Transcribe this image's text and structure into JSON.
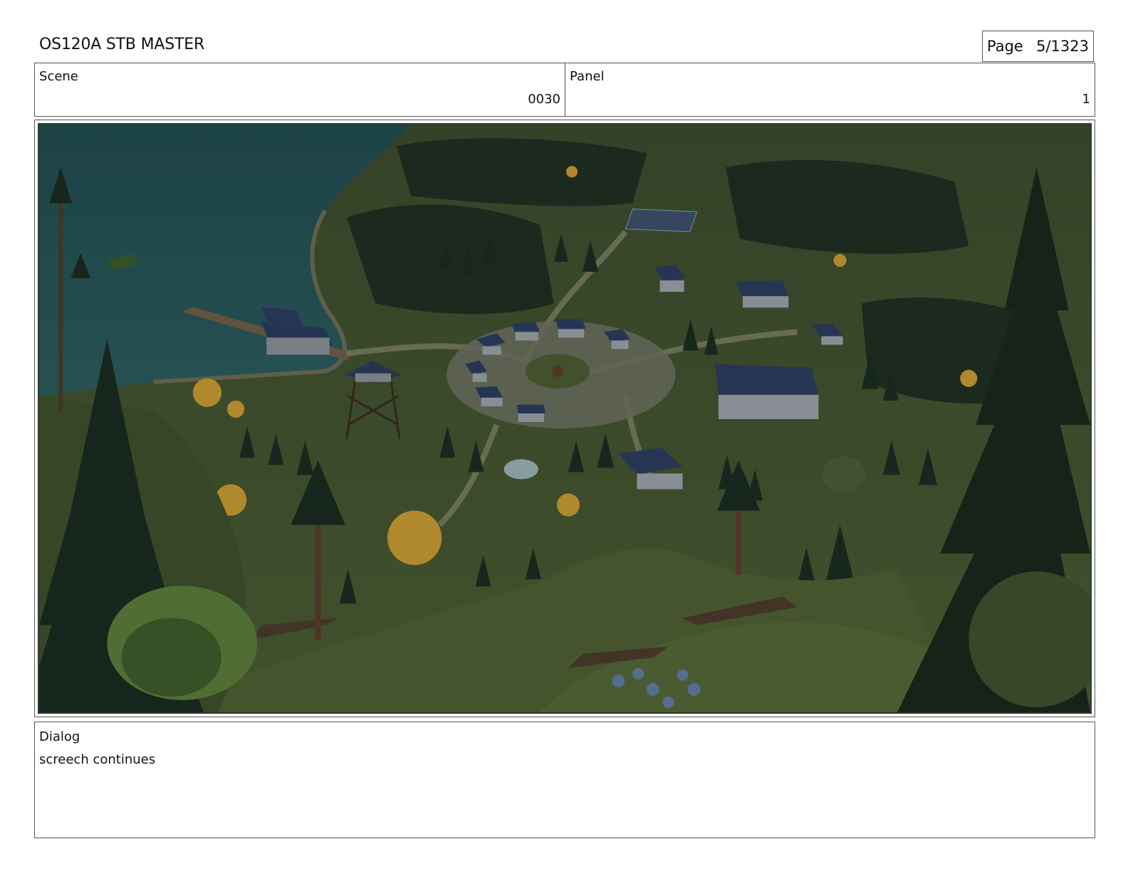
{
  "header": {
    "title": "OS120A STB MASTER",
    "page_label": "Page",
    "page_number": "5/1323"
  },
  "info": {
    "scene_label": "Scene",
    "scene_value": "0030",
    "panel_label": "Panel",
    "panel_value": "1"
  },
  "dialog": {
    "label": "Dialog",
    "text": "screech continues"
  }
}
